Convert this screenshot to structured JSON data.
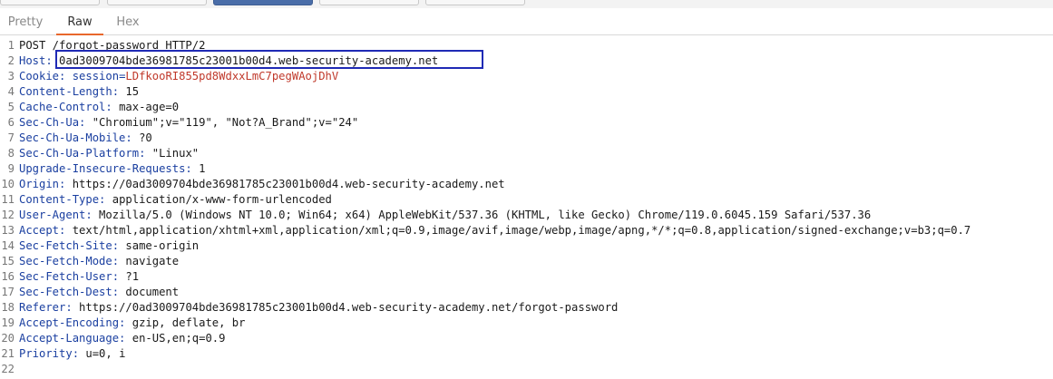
{
  "tabs": [
    {
      "label": "Pretty",
      "active": false
    },
    {
      "label": "Raw",
      "active": true
    },
    {
      "label": "Hex",
      "active": false
    }
  ],
  "request_lines": [
    {
      "num": "1",
      "parts": [
        {
          "t": "plain",
          "text": "POST /forgot-password HTTP/2"
        }
      ]
    },
    {
      "num": "2",
      "parts": [
        {
          "t": "name",
          "text": "Host:"
        },
        {
          "t": "plain",
          "text": " 0ad3009704bde36981785c23001b00d4.web-security-academy.net"
        }
      ]
    },
    {
      "num": "3",
      "parts": [
        {
          "t": "name",
          "text": "Cookie:"
        },
        {
          "t": "name",
          "text": " session="
        },
        {
          "t": "ckv",
          "text": "LDfkooRI855pd8WdxxLmC7pegWAojDhV"
        }
      ]
    },
    {
      "num": "4",
      "parts": [
        {
          "t": "name",
          "text": "Content-Length:"
        },
        {
          "t": "plain",
          "text": " 15"
        }
      ]
    },
    {
      "num": "5",
      "parts": [
        {
          "t": "name",
          "text": "Cache-Control:"
        },
        {
          "t": "plain",
          "text": " max-age=0"
        }
      ]
    },
    {
      "num": "6",
      "parts": [
        {
          "t": "name",
          "text": "Sec-Ch-Ua:"
        },
        {
          "t": "plain",
          "text": " \"Chromium\";v=\"119\", \"Not?A_Brand\";v=\"24\""
        }
      ]
    },
    {
      "num": "7",
      "parts": [
        {
          "t": "name",
          "text": "Sec-Ch-Ua-Mobile:"
        },
        {
          "t": "plain",
          "text": " ?0"
        }
      ]
    },
    {
      "num": "8",
      "parts": [
        {
          "t": "name",
          "text": "Sec-Ch-Ua-Platform:"
        },
        {
          "t": "plain",
          "text": " \"Linux\""
        }
      ]
    },
    {
      "num": "9",
      "parts": [
        {
          "t": "name",
          "text": "Upgrade-Insecure-Requests:"
        },
        {
          "t": "plain",
          "text": " 1"
        }
      ]
    },
    {
      "num": "10",
      "parts": [
        {
          "t": "name",
          "text": "Origin:"
        },
        {
          "t": "plain",
          "text": " https://0ad3009704bde36981785c23001b00d4.web-security-academy.net"
        }
      ]
    },
    {
      "num": "11",
      "parts": [
        {
          "t": "name",
          "text": "Content-Type:"
        },
        {
          "t": "plain",
          "text": " application/x-www-form-urlencoded"
        }
      ]
    },
    {
      "num": "12",
      "parts": [
        {
          "t": "name",
          "text": "User-Agent:"
        },
        {
          "t": "plain",
          "text": " Mozilla/5.0 (Windows NT 10.0; Win64; x64) AppleWebKit/537.36 (KHTML, like Gecko) Chrome/119.0.6045.159 Safari/537.36"
        }
      ]
    },
    {
      "num": "13",
      "parts": [
        {
          "t": "name",
          "text": "Accept:"
        },
        {
          "t": "plain",
          "text": " text/html,application/xhtml+xml,application/xml;q=0.9,image/avif,image/webp,image/apng,*/*;q=0.8,application/signed-exchange;v=b3;q=0.7"
        }
      ]
    },
    {
      "num": "14",
      "parts": [
        {
          "t": "name",
          "text": "Sec-Fetch-Site:"
        },
        {
          "t": "plain",
          "text": " same-origin"
        }
      ]
    },
    {
      "num": "15",
      "parts": [
        {
          "t": "name",
          "text": "Sec-Fetch-Mode:"
        },
        {
          "t": "plain",
          "text": " navigate"
        }
      ]
    },
    {
      "num": "16",
      "parts": [
        {
          "t": "name",
          "text": "Sec-Fetch-User:"
        },
        {
          "t": "plain",
          "text": " ?1"
        }
      ]
    },
    {
      "num": "17",
      "parts": [
        {
          "t": "name",
          "text": "Sec-Fetch-Dest:"
        },
        {
          "t": "plain",
          "text": " document"
        }
      ]
    },
    {
      "num": "18",
      "parts": [
        {
          "t": "name",
          "text": "Referer:"
        },
        {
          "t": "plain",
          "text": " https://0ad3009704bde36981785c23001b00d4.web-security-academy.net/forgot-password"
        }
      ]
    },
    {
      "num": "19",
      "parts": [
        {
          "t": "name",
          "text": "Accept-Encoding:"
        },
        {
          "t": "plain",
          "text": " gzip, deflate, br"
        }
      ]
    },
    {
      "num": "20",
      "parts": [
        {
          "t": "name",
          "text": "Accept-Language:"
        },
        {
          "t": "plain",
          "text": " en-US,en;q=0.9"
        }
      ]
    },
    {
      "num": "21",
      "parts": [
        {
          "t": "name",
          "text": "Priority:"
        },
        {
          "t": "plain",
          "text": " u=0, i"
        }
      ]
    },
    {
      "num": "22",
      "parts": []
    }
  ],
  "colors": {
    "header_name": "#1a3fa0",
    "cookie_value": "#c0392b",
    "highlight_box": "#1f2ab5",
    "active_tab_underline": "#e8672c"
  }
}
